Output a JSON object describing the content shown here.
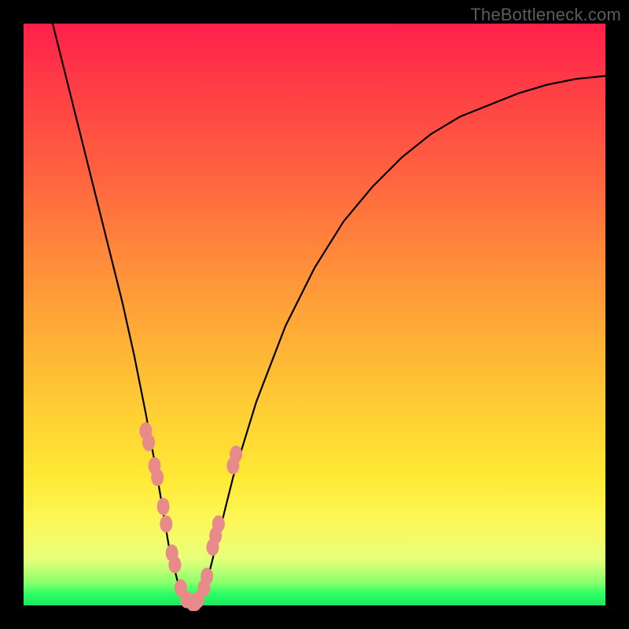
{
  "watermark": "TheBottleneck.com",
  "chart_data": {
    "type": "line",
    "title": "",
    "xlabel": "",
    "ylabel": "",
    "xlim": [
      0,
      100
    ],
    "ylim": [
      0,
      100
    ],
    "curve": {
      "name": "bottleneck-curve",
      "x": [
        5,
        7,
        9,
        11,
        13,
        15,
        17,
        19,
        21,
        23,
        25,
        27,
        29,
        31,
        33,
        36,
        40,
        45,
        50,
        55,
        60,
        65,
        70,
        75,
        80,
        85,
        90,
        95,
        100
      ],
      "y": [
        100,
        92,
        84,
        76,
        68,
        60,
        52,
        43,
        33,
        22,
        10,
        2,
        0,
        2,
        10,
        22,
        35,
        48,
        58,
        66,
        72,
        77,
        81,
        84,
        86,
        88,
        89.5,
        90.5,
        91
      ]
    },
    "markers": {
      "name": "data-points",
      "color": "#e88a8a",
      "x": [
        21,
        21.5,
        22.5,
        23,
        24,
        24.5,
        25.5,
        26,
        27,
        28,
        29,
        29.5,
        30,
        31,
        31.5,
        32.5,
        33,
        33.5,
        36,
        36.5
      ],
      "y": [
        30,
        28,
        24,
        22,
        17,
        14,
        9,
        7,
        3,
        1,
        0.5,
        0.5,
        1,
        3,
        5,
        10,
        12,
        14,
        24,
        26
      ]
    },
    "gradient_stops": [
      {
        "pos": 0.0,
        "color": "#ff1f4a"
      },
      {
        "pos": 0.4,
        "color": "#ff8a3a"
      },
      {
        "pos": 0.78,
        "color": "#ffe935"
      },
      {
        "pos": 0.96,
        "color": "#8dff6c"
      },
      {
        "pos": 1.0,
        "color": "#19e85d"
      }
    ]
  }
}
